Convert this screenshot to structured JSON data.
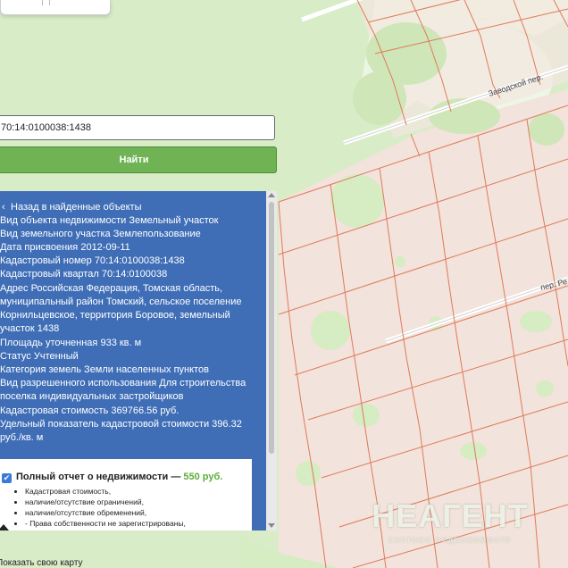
{
  "map": {
    "streets": [
      "Заводской пер.",
      "пер. Ре"
    ],
    "colors": {
      "background": "#d9ecc8",
      "parcel_fill": "#f3e4de",
      "parcel_border": "#e07a5a",
      "panel": "#3f6eb7",
      "button": "#6fb355"
    }
  },
  "search": {
    "value": "70:14:0100038:1438",
    "button_label": "Найти"
  },
  "panel": {
    "back_label": "Назад в найденные объекты",
    "rows": [
      {
        "label": "Вид объекта недвижимости",
        "value": "Земельный участок"
      },
      {
        "label": "Вид земельного участка",
        "value": "Землепользование"
      },
      {
        "label": "Дата присвоения",
        "value": "2012-09-11"
      },
      {
        "label": "Кадастровый номер",
        "value": "70:14:0100038:1438"
      },
      {
        "label": "Кадастровый квартал",
        "value": "70:14:0100038"
      },
      {
        "label": "Адрес",
        "value": "Российская Федерация, Томская область, муниципальный район Томский, сельское поселение Корнильцевское, территория Боровое, земельный участок 1438"
      },
      {
        "label": "Площадь уточненная",
        "value": "933 кв. м"
      },
      {
        "label": "Статус",
        "value": "Учтенный"
      },
      {
        "label": "Категория земель",
        "value": "Земли населенных пунктов"
      },
      {
        "label": "Вид разрешенного использования",
        "value": "Для строительства поселка индивидуальных застройщиков"
      },
      {
        "label": "Кадастровая стоимость",
        "value": "369766.56 руб."
      },
      {
        "label": "Удельный показатель кадастровой стоимости",
        "value": "396.32 руб./кв. м"
      }
    ],
    "offer": {
      "title": "Полный отчет о недвижимости —",
      "price": "550 руб.",
      "items": [
        "Кадастровая стоимость,",
        "наличие/отсутствие ограничений,",
        "наличие/отсутствие обременений,",
        "- Права собственности не зарегистрированы,"
      ]
    }
  },
  "bottom_link": "Показать свою карту",
  "watermark": {
    "brand": "НЕАГЕНТ",
    "sub": "система недвижимости"
  }
}
